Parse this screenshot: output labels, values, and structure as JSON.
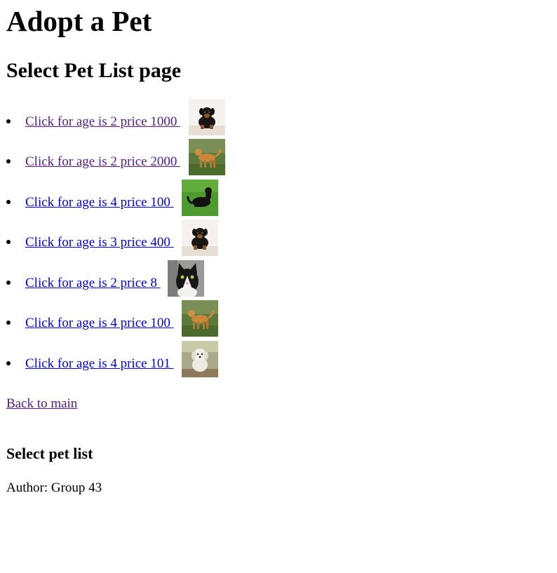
{
  "header": {
    "site_title": "Adopt a Pet",
    "page_heading": "Select Pet List page"
  },
  "pets": [
    {
      "label": "Click for age is 2 price 1000 ",
      "visited": true,
      "image": "rottweiler-puppy"
    },
    {
      "label": "Click for age is 2 price 2000 ",
      "visited": true,
      "image": "golden-retriever"
    },
    {
      "label": "Click for age is 4 price 100 ",
      "visited": false,
      "image": "black-dog-on-grass"
    },
    {
      "label": "Click for age is 3 price 400 ",
      "visited": false,
      "image": "rottweiler-puppy"
    },
    {
      "label": "Click for age is 2 price 8 ",
      "visited": false,
      "image": "black-white-cat"
    },
    {
      "label": "Click for age is 4 price 100 ",
      "visited": false,
      "image": "golden-retriever"
    },
    {
      "label": "Click for age is 4 price 101 ",
      "visited": false,
      "image": "white-puppy"
    }
  ],
  "back_link": "Back to main",
  "footer": {
    "title": "Select pet list",
    "author": "Author: Group 43"
  }
}
